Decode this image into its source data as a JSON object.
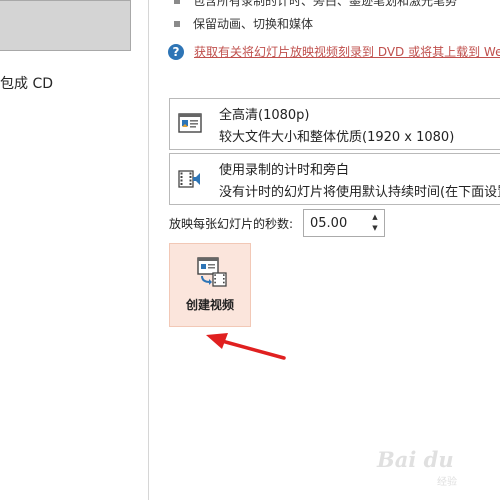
{
  "left_panel": {
    "selected_item": "",
    "item_label": "包成 CD"
  },
  "bullets": [
    {
      "text": "包含所有录制的计时、旁白、墨迹笔划和激光笔势"
    },
    {
      "text": "保留动画、切换和媒体"
    }
  ],
  "help": {
    "icon": "question-circle-icon",
    "link_text": "获取有关将幻灯片放映视频刻录到 DVD 或将其上载到 We"
  },
  "options": [
    {
      "icon": "presentation-screen-icon",
      "title": "全高清(1080p)",
      "subtitle": "较大文件大小和整体优质(1920 x 1080)"
    },
    {
      "icon": "film-speaker-icon",
      "title": "使用录制的计时和旁白",
      "subtitle": "没有计时的幻灯片将使用默认持续时间(在下面设置"
    }
  ],
  "seconds": {
    "label": "放映每张幻灯片的秒数:",
    "value": "05.00"
  },
  "create_button": {
    "icon": "create-video-icon",
    "label": "创建视频"
  },
  "watermark": {
    "text": "Bai du",
    "sub": "经验"
  },
  "colors": {
    "link": "#c0504d",
    "help_icon": "#2e75b6",
    "create_bg": "#fbe5dc",
    "arrow": "#e02020"
  }
}
